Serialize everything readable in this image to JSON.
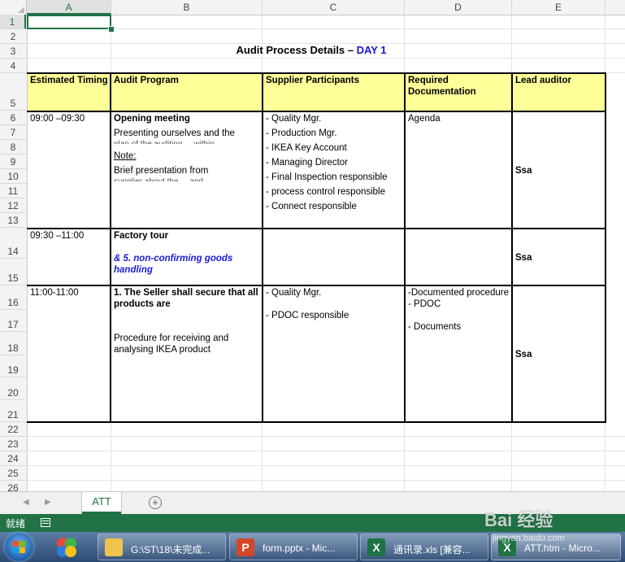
{
  "columns": [
    "A",
    "B",
    "C",
    "D",
    "E"
  ],
  "rows": [
    "1",
    "2",
    "3",
    "4",
    "5",
    "6",
    "7",
    "8",
    "9",
    "10",
    "11",
    "12",
    "13",
    "14",
    "15",
    "16",
    "17",
    "18",
    "19",
    "20",
    "21",
    "22",
    "23",
    "24",
    "25",
    "26"
  ],
  "sheet": {
    "title": "Audit Process Details – ",
    "title_day": "DAY 1",
    "headers": [
      "Estimated Timing",
      "Audit Program",
      "Supplier Participants",
      "Required Documentation",
      "Lead auditor"
    ],
    "rows": [
      {
        "timing": "09:00 –09:30",
        "program_title": "Opening meeting",
        "program_line1": "Presenting ourselves and the",
        "program_line2": "plan of the auditing ... within",
        "program_note": "Note:",
        "program_line3": "Brief presentation from",
        "program_line4": "supplier about the ... and",
        "participants": [
          "- Quality Mgr.",
          "- Production Mgr.",
          "- IKEA Key Account",
          "- Managing Director",
          "- Final Inspection responsible",
          "- process control responsible",
          "- Connect responsible"
        ],
        "documentation": "Agenda",
        "lead": "Ssa"
      },
      {
        "timing": "09:30 –11:00",
        "program_title": "Factory tour",
        "program_link": "& 5. non-confirming goods handling",
        "lead": "Ssa"
      },
      {
        "timing": "11:00-11:00",
        "program_title": "1. The Seller shall secure that all products are",
        "program_line1": "Procedure for receiving and analysing IKEA product",
        "participants": [
          "- Quality Mgr.",
          "- PDOC responsible"
        ],
        "documentation": [
          "-Documented procedure",
          "- PDOC",
          "- Documents"
        ],
        "lead": "Ssa"
      }
    ]
  },
  "sheet_tab": "ATT",
  "status": "就绪",
  "taskbar": {
    "items": [
      {
        "label": "G:\\ST\\18\\未完成..."
      },
      {
        "label": "form.pptx - Mic..."
      },
      {
        "label": "通讯录.xls [兼容..."
      },
      {
        "label": "ATT.htm - Micro..."
      }
    ]
  },
  "watermark": "Bai 经验",
  "watermark_sub": "jingyan.baidu.com"
}
